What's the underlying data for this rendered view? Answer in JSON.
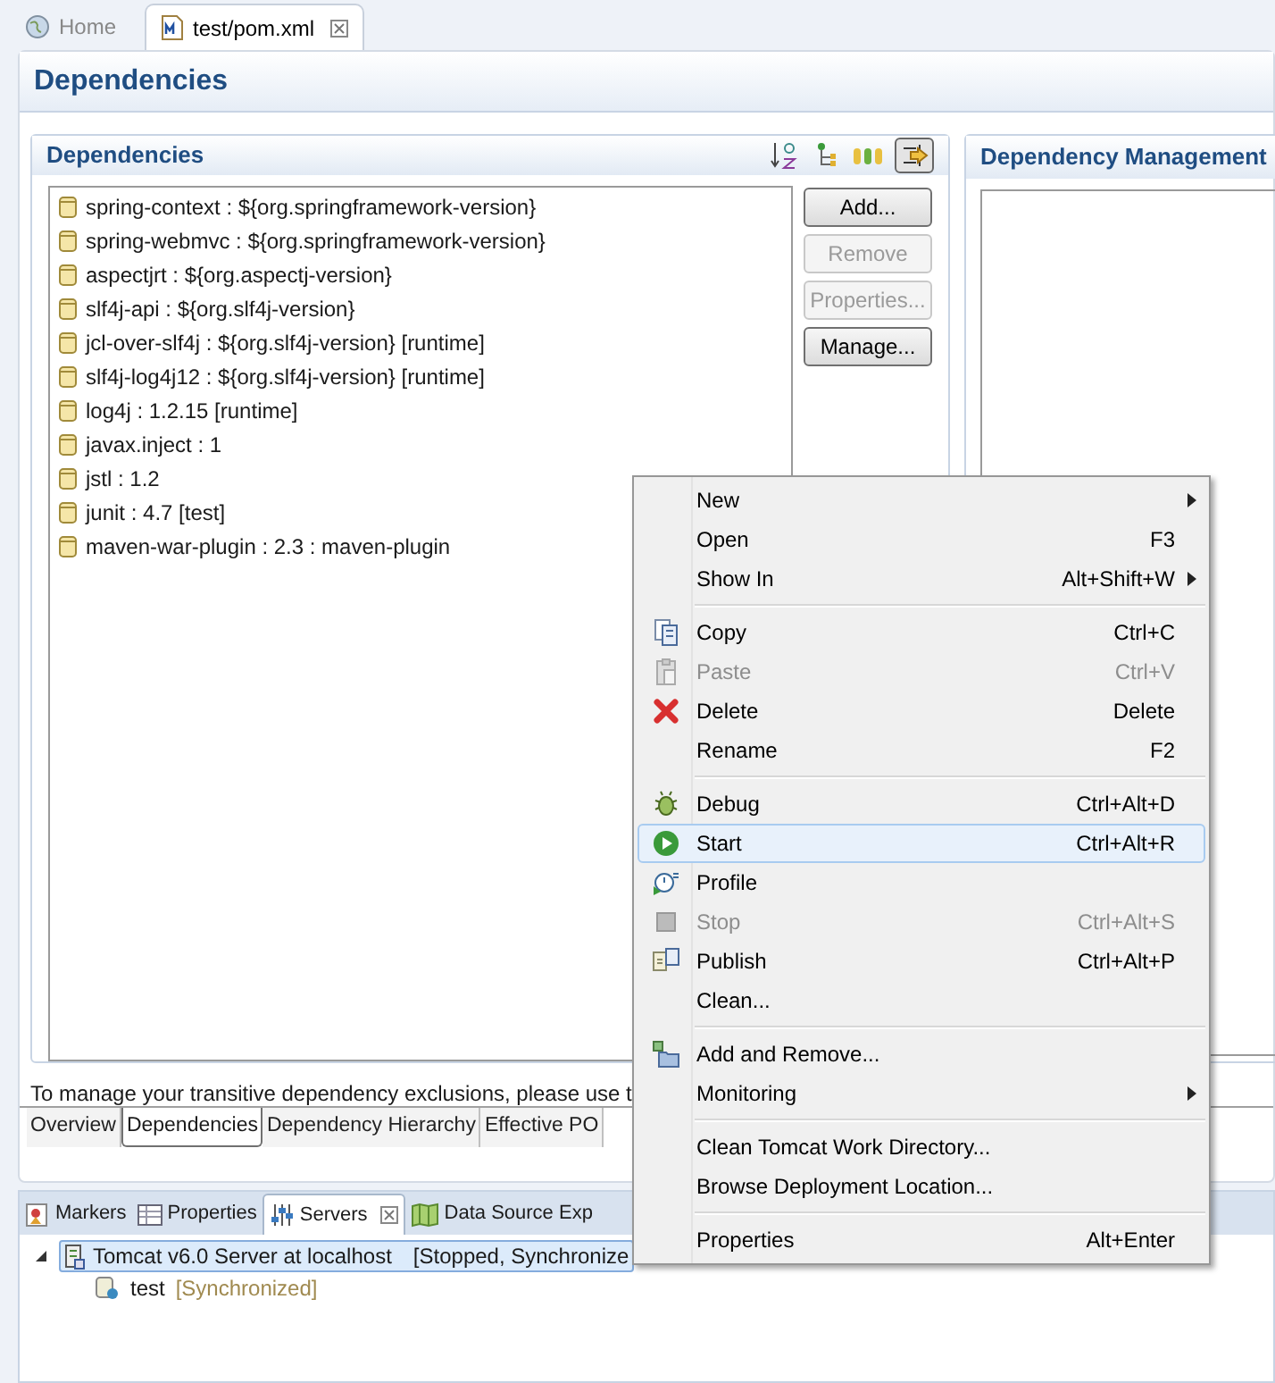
{
  "editor_tabs": [
    {
      "label": "Home",
      "selected": false,
      "closable": false
    },
    {
      "label": "test/pom.xml",
      "selected": true,
      "closable": true
    }
  ],
  "page_title": "Dependencies",
  "dependencies": {
    "title": "Dependencies",
    "items": [
      "spring-context : ${org.springframework-version}",
      "spring-webmvc : ${org.springframework-version}",
      "aspectjrt : ${org.aspectj-version}",
      "slf4j-api : ${org.slf4j-version}",
      "jcl-over-slf4j : ${org.slf4j-version} [runtime]",
      "slf4j-log4j12 : ${org.slf4j-version} [runtime]",
      "log4j : 1.2.15 [runtime]",
      "javax.inject : 1",
      "jstl : 1.2",
      "junit : 4.7 [test]",
      "maven-war-plugin : 2.3 : maven-plugin"
    ],
    "buttons": [
      {
        "label": "Add...",
        "disabled": false
      },
      {
        "label": "Remove",
        "disabled": true
      },
      {
        "label": "Properties...",
        "disabled": true
      },
      {
        "label": "Manage...",
        "disabled": false
      }
    ]
  },
  "dependency_management": {
    "title": "Dependency Management"
  },
  "hint": "To manage your transitive dependency exclusions, please use t",
  "page_tabs": [
    {
      "label": "Overview",
      "selected": false
    },
    {
      "label": "Dependencies",
      "selected": true
    },
    {
      "label": "Dependency Hierarchy",
      "selected": false
    },
    {
      "label": "Effective PO",
      "selected": false
    }
  ],
  "view_tabs": [
    {
      "label": "Markers",
      "selected": false,
      "closable": false
    },
    {
      "label": "Properties",
      "selected": false,
      "closable": false
    },
    {
      "label": "Servers",
      "selected": true,
      "closable": true
    },
    {
      "label": "Data Source Exp",
      "selected": false,
      "closable": false
    }
  ],
  "servers": [
    {
      "name": "Tomcat v6.0 Server at localhost",
      "status": "[Stopped, Synchronize",
      "expanded": true,
      "selected": true,
      "children": [
        {
          "name": "test",
          "status": "[Synchronized]"
        }
      ]
    }
  ],
  "context_menu": [
    {
      "kind": "item",
      "label": "New",
      "submenu": true,
      "disabled": false,
      "selected": false
    },
    {
      "kind": "item",
      "label": "Open",
      "shortcut": "F3",
      "submenu": false,
      "disabled": false,
      "selected": false
    },
    {
      "kind": "item",
      "label": "Show In",
      "shortcut": "Alt+Shift+W",
      "submenu": true,
      "disabled": false,
      "selected": false
    },
    {
      "kind": "separator"
    },
    {
      "kind": "item",
      "label": "Copy",
      "shortcut": "Ctrl+C",
      "submenu": false,
      "disabled": false,
      "selected": false
    },
    {
      "kind": "item",
      "label": "Paste",
      "shortcut": "Ctrl+V",
      "submenu": false,
      "disabled": true,
      "selected": false
    },
    {
      "kind": "item",
      "label": "Delete",
      "shortcut": "Delete",
      "submenu": false,
      "disabled": false,
      "selected": false
    },
    {
      "kind": "item",
      "label": "Rename",
      "shortcut": "F2",
      "submenu": false,
      "disabled": false,
      "selected": false
    },
    {
      "kind": "separator"
    },
    {
      "kind": "item",
      "label": "Debug",
      "shortcut": "Ctrl+Alt+D",
      "submenu": false,
      "disabled": false,
      "selected": false
    },
    {
      "kind": "item",
      "label": "Start",
      "shortcut": "Ctrl+Alt+R",
      "submenu": false,
      "disabled": false,
      "selected": true
    },
    {
      "kind": "item",
      "label": "Profile",
      "submenu": false,
      "disabled": false,
      "selected": false
    },
    {
      "kind": "item",
      "label": "Stop",
      "shortcut": "Ctrl+Alt+S",
      "submenu": false,
      "disabled": true,
      "selected": false
    },
    {
      "kind": "item",
      "label": "Publish",
      "shortcut": "Ctrl+Alt+P",
      "submenu": false,
      "disabled": false,
      "selected": false
    },
    {
      "kind": "item",
      "label": "Clean...",
      "submenu": false,
      "disabled": false,
      "selected": false
    },
    {
      "kind": "separator"
    },
    {
      "kind": "item",
      "label": "Add and Remove...",
      "submenu": false,
      "disabled": false,
      "selected": false
    },
    {
      "kind": "item",
      "label": "Monitoring",
      "submenu": true,
      "disabled": false,
      "selected": false
    },
    {
      "kind": "separator"
    },
    {
      "kind": "item",
      "label": "Clean Tomcat Work Directory...",
      "submenu": false,
      "disabled": false,
      "selected": false
    },
    {
      "kind": "item",
      "label": "Browse Deployment Location...",
      "submenu": false,
      "disabled": false,
      "selected": false
    },
    {
      "kind": "separator"
    },
    {
      "kind": "item",
      "label": "Properties",
      "shortcut": "Alt+Enter",
      "submenu": false,
      "disabled": false,
      "selected": false
    }
  ]
}
